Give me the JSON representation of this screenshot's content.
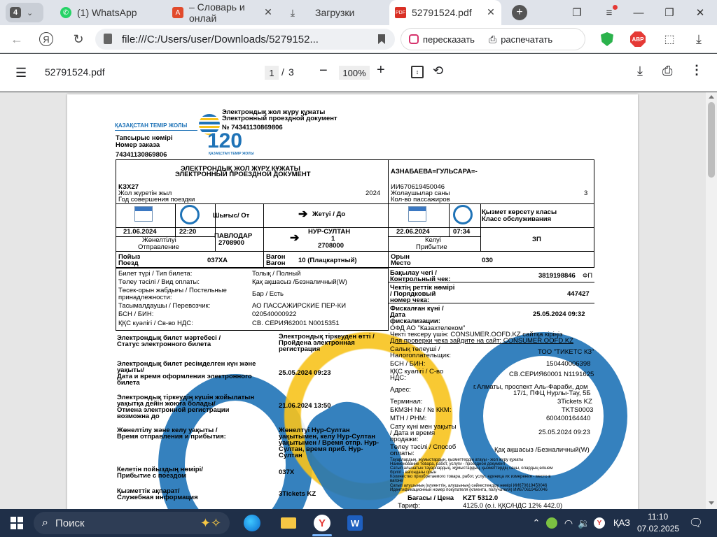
{
  "browser": {
    "tab_counter": "4",
    "tabs": [
      {
        "title": "(1) WhatsApp",
        "icon": "whatsapp-icon"
      },
      {
        "title": "– Словарь и онлай",
        "icon": "translator-icon"
      },
      {
        "title": "Загрузки",
        "icon": "download-icon"
      },
      {
        "title": "52791524.pdf",
        "icon": "pdf-icon",
        "active": true
      }
    ],
    "url": "file:///C:/Users/user/Downloads/5279152...",
    "retell_label": "пересказать",
    "print_label": "распечатать",
    "adblock_label": "ABP"
  },
  "pdf_toolbar": {
    "filename": "52791524.pdf",
    "page_current": "1",
    "page_sep": "/",
    "page_total": "3",
    "zoom": "100%"
  },
  "ticket": {
    "logo_text": "ҚАЗАҚСТАН ТЕМІР ЖОЛЫ",
    "logo_120": "120",
    "logo_sub": "ҚАЗАҚСТАН ТЕМІР ЖОЛЫ",
    "doc_title_kz": "Электрондық жол жүру құжаты",
    "doc_title_ru": "Электронный проездной документ",
    "doc_no": "№ 74341130869806",
    "order_kz": "Тапсырыс нөмірі",
    "order_ru": "Номер заказа",
    "order_no": "74341130869806",
    "box_title_kz": "ЭЛЕКТРОНДЫҚ ЖОЛ ЖҮРУ ҚҰЖАТЫ",
    "box_title_ru": "ЭЛЕКТРОННЫЙ ПРОЕЗДНОЙ ДОКУМЕНТ",
    "passenger": "АЗНАБАЕВА=ГУЛЬСАРА=-",
    "kzx": "КЗХ27",
    "year_kz": "Жол жүретін жыл",
    "year_ru": "Год совершения поездки",
    "year": "2024",
    "iin": "ИИ670619450046",
    "pax_kz": "Жолаушылар саны",
    "pax_ru": "Кол-во пассажиров",
    "pax": "3",
    "from_label": "Шығыс/ От",
    "to_label": "Жетуі / До",
    "service_kz": "Қызмет көрсету класы",
    "service_ru": "Класс обслуживания",
    "dep_date": "21.06.2024",
    "dep_time": "22:20",
    "dep_kz": "Жөнелтілуі",
    "dep_ru": "Отправление",
    "from_station": "ПАВЛОДАР",
    "from_code": "2708900",
    "to_station": "НУР-СУЛТАН",
    "to_num": "1",
    "to_code": "2708000",
    "arr_date": "22.06.2024",
    "arr_time": "07:34",
    "arr_kz": "Келуі",
    "arr_ru": "Прибытие",
    "class": "ЗП",
    "train_kz": "Пойыз",
    "train_ru": "Поезд",
    "train": "037ХА",
    "car_kz": "Вагон",
    "car_ru": "Вагон",
    "car": "10 (Плацкартный)",
    "seat_kz": "Орын",
    "seat_ru": "Место",
    "seat": "030",
    "left_rows": [
      {
        "label": "Билет түрі / Тип билета:",
        "value": "Толық / Полный"
      },
      {
        "label": "Төлеу тәсілі / Вид оплаты:",
        "value": "Қақ ақшасыз /Безналичный(W)"
      },
      {
        "label": "Төсек-орын жабдығы / Постельные",
        "label2": "принадлежности:",
        "value": "Бар / Есть"
      },
      {
        "label": "Тасымалдаушы / Перевозчик:",
        "value": "АО ПАССАЖИРСКИЕ ПЕР-КИ"
      },
      {
        "label": "БСН / БИН:",
        "value": "020540000922"
      },
      {
        "label": "ҚҚС куәлігі / Св-во НДС:",
        "value": "СВ. СЕРИЯ62001 N0015351"
      }
    ],
    "status_kz": "Электрондық билет мәртебесі /",
    "status_ru": "Статус электронного билета",
    "status_val1": "Электрондық тіркеуден өтті /",
    "status_val2": "Пройдена электронная",
    "status_val3": "регистрация",
    "issue_kz": "Электрондық билет ресімделген күн және",
    "issue_kz2": "уақыты/",
    "issue_ru": "Дата и время оформления электронного",
    "issue_ru2": "билета",
    "issue_val": "25.05.2024 09:23",
    "cancel_kz": "Электрондық тіркеудің күшін жойылатын",
    "cancel_kz2": "уақытқа дейін жоюға болады/",
    "cancel_ru": "Отмена электронной регистрации",
    "cancel_ru2": "возможна до",
    "cancel_val": "21.06.2024 13:50",
    "times_kz": "Жөнелтілу және келу уақыты /",
    "times_ru": "Время отправления и прибытия:",
    "times_val1": "Жөнелтуі Нур-Султан",
    "times_val2": "уақытымен, келу Нур-Султан",
    "times_val3": "уақытымен / Время отпр. Нур-",
    "times_val4": "Султан, время приб. Нур-",
    "times_val5": "Султан",
    "arrtrain_kz": "Келетін пойыздың нөмірі/",
    "arrtrain_ru": "Прибытие с поездом",
    "arrtrain_val": "037Х",
    "service_info_kz": "Қызметтік ақпарат/",
    "service_info_ru": "Служебная информация",
    "service_info_val": "3Tickets KZ",
    "right": {
      "control_kz": "Бақылау чегі /",
      "control_ru": "Контрольный чек:",
      "control_val": "3819198846",
      "control_unit": "ФП",
      "order_kz": "Чектің реттік нөмірі",
      "order_kz2": "/ Порядковый",
      "order_ru": "номер чека:",
      "order_val": "447427",
      "fisc_kz": "Фискалған күні /",
      "fisc_kz2": "Дата",
      "fisc_ru": "фискализации:",
      "fisc_val": "25.05.2024 09:32",
      "ofd": "ОФД АО \"Казахтелеком\"",
      "check1": "Чекті тексеру үшін: CONSUMER.OOFD.KZ сайтқа кіріңіз",
      "check2": "Для проверки чека зайдите на сайт: CONSUMER.OOFD.KZ",
      "taxpayer_kz": "Салық төлеуші /",
      "taxpayer_ru": "Налогоплательщик:",
      "taxpayer_val": "ТОО \"ТИКЕТС КЗ\"",
      "bin_label": "БСН / БИН:",
      "bin_val": "150440006398",
      "vat_label": "ҚҚС куәлігі / С-во",
      "vat_label2": "НДС:",
      "vat_val": "СВ.СЕРИЯ60001 N1191625",
      "addr_label": "Адрес:",
      "addr_val1": "г.Алматы, проспект Аль-Фараби, дом",
      "addr_val2": "17/1, ПФЦ Нурлы-Тау, 5Б",
      "term_label": "Терминал:",
      "term_val": "3Tickets KZ",
      "kkm_label": "БКМЗН № / № ККМ:",
      "kkm_val": "TKTS0003",
      "rnm_label": "МТН / РНМ:",
      "rnm_val": "600400164440",
      "sale_kz": "Сату күні мен уақыты",
      "sale_ru": "/ Дата и время",
      "sale_ru2": "продажи:",
      "sale_val": "25.05.2024 09:23",
      "pay_kz": "Төлеу тәсілі / Способ",
      "pay_ru": "оплаты:",
      "pay_val": "Қақ ақшасыз /Безналичный(W)",
      "goods1": "Тауарлардың, жұмыстардың, қызметтердің атауы - жол жүру құжаты",
      "goods2": "Наименование товара, работ, услуги - проездной документ",
      "goods3": "Сатып алынатын тауарлардың, жұмыстардың, қызметтердің саны, олардың өлшем",
      "goods4": "бірлігі - вагондағы орын",
      "goods5": "Количество приобретаемого товара, работ, услуг, единица их измерения - место в",
      "goods6": "вагоне",
      "goods7": "Сатып алушының (клиенттің, алушының) сәйкестендіру нөмірі ИИ670619450046",
      "goods8": "Идентификационный номер покупателя (клиента, получателя) ИИ670619450046",
      "price_label": "Бағасы / Цена",
      "price_val": "KZT 5312.0",
      "tariff_label": "Тариф:",
      "tariff_val": "4125.0 (о.і. ҚҚС/НДС 12% 442.0)"
    }
  },
  "taskbar": {
    "search_label": "Поиск",
    "lang": "ҚАЗ",
    "time": "11:10",
    "date": "07.02.2025"
  }
}
